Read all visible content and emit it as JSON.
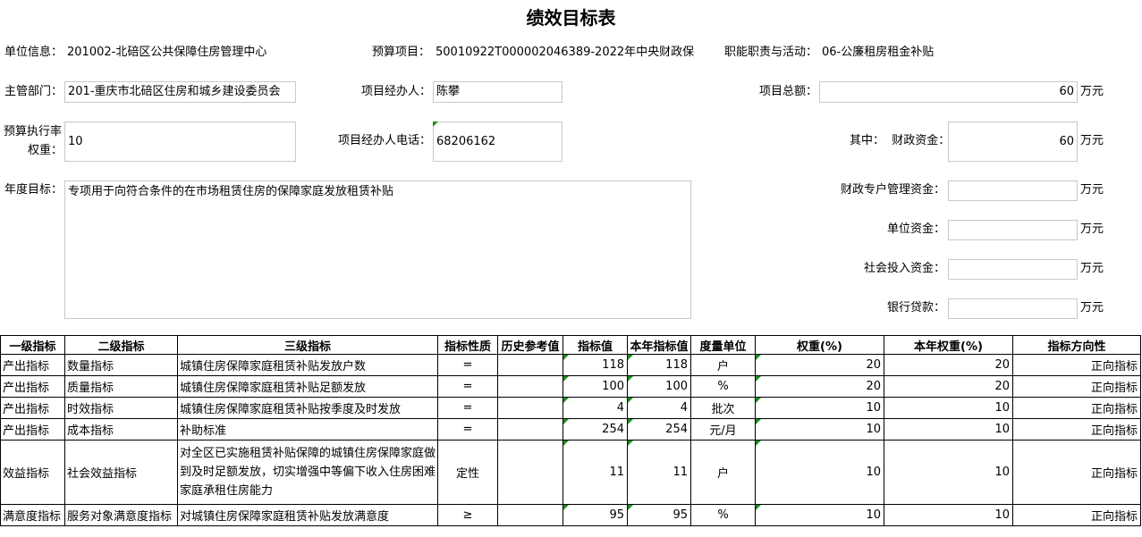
{
  "title": "绩效目标表",
  "info": {
    "unit_label": "单位信息：",
    "unit_value": "201002-北碚区公共保障住房管理中心",
    "budget_item_label": "预算项目：",
    "budget_item_value": "50010922T000002046389-2022年中央财政保",
    "function_label": "职能职责与活动：",
    "function_value": "06-公廉租房租金补贴",
    "dept_label": "主管部门：",
    "dept_value": "201-重庆市北碚区住房和城乡建设委员会",
    "manager_label": "项目经办人：",
    "manager_value": "陈攀",
    "total_label": "项目总额：",
    "total_value": "60",
    "unit_wan": "万元",
    "exec_label_1": "预算执行率",
    "exec_label_2": "权重：",
    "exec_value": "10",
    "phone_label": "项目经办人电话：",
    "phone_value": "68206162",
    "fiscal_label": "其中：  财政资金：",
    "fiscal_value": "60",
    "goal_label": "年度目标：",
    "goal_value": "专项用于向符合条件的在市场租赁住房的保障家庭发放租赁补贴",
    "special_label": "财政专户管理资金：",
    "special_value": "",
    "unitfund_label": "单位资金：",
    "unitfund_value": "",
    "social_label": "社会投入资金：",
    "social_value": "",
    "loan_label": "银行贷款：",
    "loan_value": ""
  },
  "table": {
    "headers": [
      "一级指标",
      "二级指标",
      "三级指标",
      "指标性质",
      "历史参考值",
      "指标值",
      "本年指标值",
      "度量单位",
      "权重(%)",
      "本年权重(%)",
      "指标方向性"
    ],
    "rows": [
      [
        "产出指标",
        "数量指标",
        "城镇住房保障家庭租赁补贴发放户数",
        "=",
        "",
        "118",
        "118",
        "户",
        "20",
        "20",
        "正向指标"
      ],
      [
        "产出指标",
        "质量指标",
        "城镇住房保障家庭租赁补贴足额发放",
        "=",
        "",
        "100",
        "100",
        "%",
        "20",
        "20",
        "正向指标"
      ],
      [
        "产出指标",
        "时效指标",
        "城镇住房保障家庭租赁补贴按季度及时发放",
        "=",
        "",
        "4",
        "4",
        "批次",
        "10",
        "10",
        "正向指标"
      ],
      [
        "产出指标",
        "成本指标",
        "补助标准",
        "=",
        "",
        "254",
        "254",
        "元/月",
        "10",
        "10",
        "正向指标"
      ],
      [
        "效益指标",
        "社会效益指标",
        "对全区已实施租赁补贴保障的城镇住房保障家庭做到及时足额发放，切实增强中等偏下收入住房困难家庭承租住房能力",
        "定性",
        "",
        "11",
        "11",
        "户",
        "10",
        "10",
        "正向指标"
      ],
      [
        "满意度指标",
        "服务对象满意度指标",
        "对城镇住房保障家庭租赁补贴发放满意度",
        "≥",
        "",
        "95",
        "95",
        "%",
        "10",
        "10",
        "正向指标"
      ]
    ]
  }
}
